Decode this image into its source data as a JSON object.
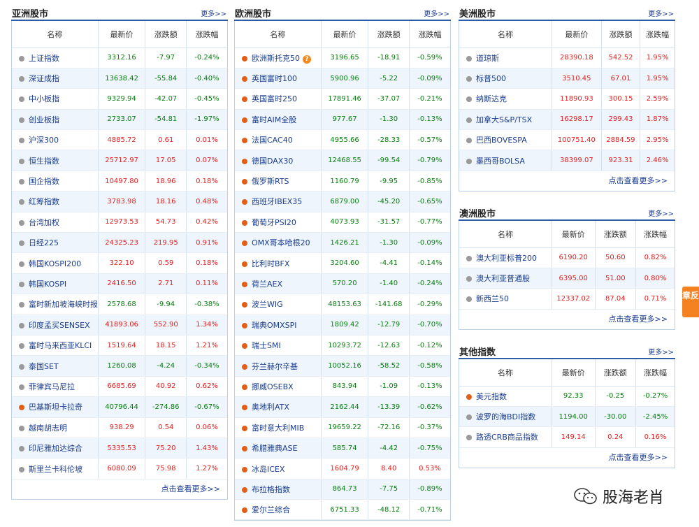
{
  "asia": {
    "title": "亚洲股市",
    "more": "更多>>",
    "footer": "点击查看更多>>",
    "headers": [
      "名称",
      "最新价",
      "涨跌额",
      "涨跌幅"
    ],
    "rows": [
      {
        "name": "上证指数",
        "price": "3312.16",
        "change": "-7.97",
        "pct": "-0.24%",
        "dot": "gray",
        "dir": "down"
      },
      {
        "name": "深证成指",
        "price": "13638.42",
        "change": "-55.84",
        "pct": "-0.40%",
        "dot": "gray",
        "dir": "down"
      },
      {
        "name": "中小板指",
        "price": "9329.94",
        "change": "-42.07",
        "pct": "-0.45%",
        "dot": "gray",
        "dir": "down"
      },
      {
        "name": "创业板指",
        "price": "2733.07",
        "change": "-54.81",
        "pct": "-1.97%",
        "dot": "gray",
        "dir": "down"
      },
      {
        "name": "沪深300",
        "price": "4885.72",
        "change": "0.61",
        "pct": "0.01%",
        "dot": "gray",
        "dir": "up"
      },
      {
        "name": "恒生指数",
        "price": "25712.97",
        "change": "17.05",
        "pct": "0.07%",
        "dot": "gray",
        "dir": "up"
      },
      {
        "name": "国企指数",
        "price": "10497.80",
        "change": "18.96",
        "pct": "0.18%",
        "dot": "gray",
        "dir": "up"
      },
      {
        "name": "红筹指数",
        "price": "3783.98",
        "change": "18.16",
        "pct": "0.48%",
        "dot": "gray",
        "dir": "up"
      },
      {
        "name": "台湾加权",
        "price": "12973.53",
        "change": "54.73",
        "pct": "0.42%",
        "dot": "gray",
        "dir": "up"
      },
      {
        "name": "日经225",
        "price": "24325.23",
        "change": "219.95",
        "pct": "0.91%",
        "dot": "gray",
        "dir": "up"
      },
      {
        "name": "韩国KOSPI200",
        "price": "322.10",
        "change": "0.59",
        "pct": "0.18%",
        "dot": "gray",
        "dir": "up"
      },
      {
        "name": "韩国KOSPI",
        "price": "2416.50",
        "change": "2.71",
        "pct": "0.11%",
        "dot": "gray",
        "dir": "up"
      },
      {
        "name": "富时新加坡海峡时报",
        "price": "2578.68",
        "change": "-9.94",
        "pct": "-0.38%",
        "dot": "gray",
        "dir": "down"
      },
      {
        "name": "印度孟买SENSEX",
        "price": "41893.06",
        "change": "552.90",
        "pct": "1.34%",
        "dot": "gray",
        "dir": "up"
      },
      {
        "name": "富时马来西亚KLCI",
        "price": "1519.64",
        "change": "18.15",
        "pct": "1.21%",
        "dot": "gray",
        "dir": "up"
      },
      {
        "name": "泰国SET",
        "price": "1260.08",
        "change": "-4.24",
        "pct": "-0.34%",
        "dot": "gray",
        "dir": "down"
      },
      {
        "name": "菲律宾马尼拉",
        "price": "6685.69",
        "change": "40.92",
        "pct": "0.62%",
        "dot": "gray",
        "dir": "up"
      },
      {
        "name": "巴基斯坦卡拉奇",
        "price": "40796.44",
        "change": "-274.86",
        "pct": "-0.67%",
        "dot": "orange",
        "dir": "down"
      },
      {
        "name": "越南胡志明",
        "price": "938.29",
        "change": "0.54",
        "pct": "0.06%",
        "dot": "gray",
        "dir": "up"
      },
      {
        "name": "印尼雅加达综合",
        "price": "5335.53",
        "change": "75.20",
        "pct": "1.43%",
        "dot": "gray",
        "dir": "up"
      },
      {
        "name": "斯里兰卡科伦坡",
        "price": "6080.09",
        "change": "75.98",
        "pct": "1.27%",
        "dot": "gray",
        "dir": "up"
      }
    ]
  },
  "europe": {
    "title": "欧洲股市",
    "more": "更多>>",
    "headers": [
      "名称",
      "最新价",
      "涨跌额",
      "涨跌幅"
    ],
    "rows": [
      {
        "name": "欧洲斯托克50",
        "price": "3196.65",
        "change": "-18.91",
        "pct": "-0.59%",
        "dot": "orange",
        "dir": "down",
        "help": "?"
      },
      {
        "name": "英国富时100",
        "price": "5900.96",
        "change": "-5.22",
        "pct": "-0.09%",
        "dot": "orange",
        "dir": "down"
      },
      {
        "name": "英国富时250",
        "price": "17891.46",
        "change": "-37.07",
        "pct": "-0.21%",
        "dot": "orange",
        "dir": "down"
      },
      {
        "name": "富时AIM全股",
        "price": "977.67",
        "change": "-1.30",
        "pct": "-0.13%",
        "dot": "orange",
        "dir": "down"
      },
      {
        "name": "法国CAC40",
        "price": "4955.66",
        "change": "-28.33",
        "pct": "-0.57%",
        "dot": "orange",
        "dir": "down"
      },
      {
        "name": "德国DAX30",
        "price": "12468.55",
        "change": "-99.54",
        "pct": "-0.79%",
        "dot": "orange",
        "dir": "down"
      },
      {
        "name": "俄罗斯RTS",
        "price": "1160.79",
        "change": "-9.95",
        "pct": "-0.85%",
        "dot": "orange",
        "dir": "down"
      },
      {
        "name": "西班牙IBEX35",
        "price": "6879.00",
        "change": "-45.20",
        "pct": "-0.65%",
        "dot": "orange",
        "dir": "down"
      },
      {
        "name": "葡萄牙PSI20",
        "price": "4073.93",
        "change": "-31.57",
        "pct": "-0.77%",
        "dot": "orange",
        "dir": "down"
      },
      {
        "name": "OMX哥本哈根20",
        "price": "1426.21",
        "change": "-1.30",
        "pct": "-0.09%",
        "dot": "orange",
        "dir": "down"
      },
      {
        "name": "比利时BFX",
        "price": "3204.60",
        "change": "-4.41",
        "pct": "-0.14%",
        "dot": "orange",
        "dir": "down"
      },
      {
        "name": "荷兰AEX",
        "price": "570.20",
        "change": "-1.40",
        "pct": "-0.24%",
        "dot": "orange",
        "dir": "down"
      },
      {
        "name": "波兰WIG",
        "price": "48153.63",
        "change": "-141.68",
        "pct": "-0.29%",
        "dot": "orange",
        "dir": "down"
      },
      {
        "name": "瑞典OMXSPI",
        "price": "1809.42",
        "change": "-12.79",
        "pct": "-0.70%",
        "dot": "orange",
        "dir": "down"
      },
      {
        "name": "瑞士SMI",
        "price": "10293.72",
        "change": "-12.63",
        "pct": "-0.12%",
        "dot": "orange",
        "dir": "down"
      },
      {
        "name": "芬兰赫尔辛基",
        "price": "10052.16",
        "change": "-58.52",
        "pct": "-0.58%",
        "dot": "orange",
        "dir": "down"
      },
      {
        "name": "挪威OSEBX",
        "price": "843.94",
        "change": "-1.09",
        "pct": "-0.13%",
        "dot": "orange",
        "dir": "down"
      },
      {
        "name": "奥地利ATX",
        "price": "2162.44",
        "change": "-13.39",
        "pct": "-0.62%",
        "dot": "orange",
        "dir": "down"
      },
      {
        "name": "富时意大利MIB",
        "price": "19659.22",
        "change": "-72.16",
        "pct": "-0.37%",
        "dot": "orange",
        "dir": "down"
      },
      {
        "name": "希腊雅典ASE",
        "price": "585.74",
        "change": "-4.42",
        "pct": "-0.75%",
        "dot": "orange",
        "dir": "down"
      },
      {
        "name": "冰岛ICEX",
        "price": "1604.79",
        "change": "8.40",
        "pct": "0.53%",
        "dot": "orange",
        "dir": "up"
      },
      {
        "name": "布拉格指数",
        "price": "864.73",
        "change": "-7.75",
        "pct": "-0.89%",
        "dot": "orange",
        "dir": "down"
      },
      {
        "name": "爱尔兰综合",
        "price": "6751.33",
        "change": "-48.12",
        "pct": "-0.71%",
        "dot": "orange",
        "dir": "down"
      }
    ]
  },
  "america": {
    "title": "美洲股市",
    "more": "更多>>",
    "footer": "点击查看更多>>",
    "headers": [
      "名称",
      "最新价",
      "涨跌额",
      "涨跌幅"
    ],
    "rows": [
      {
        "name": "道琼斯",
        "price": "28390.18",
        "change": "542.52",
        "pct": "1.95%",
        "dot": "gray",
        "dir": "up"
      },
      {
        "name": "标普500",
        "price": "3510.45",
        "change": "67.01",
        "pct": "1.95%",
        "dot": "gray",
        "dir": "up"
      },
      {
        "name": "纳斯达克",
        "price": "11890.93",
        "change": "300.15",
        "pct": "2.59%",
        "dot": "gray",
        "dir": "up"
      },
      {
        "name": "加拿大S&P/TSX",
        "price": "16298.17",
        "change": "299.43",
        "pct": "1.87%",
        "dot": "gray",
        "dir": "up"
      },
      {
        "name": "巴西BOVESPA",
        "price": "100751.40",
        "change": "2884.59",
        "pct": "2.95%",
        "dot": "gray",
        "dir": "up"
      },
      {
        "name": "墨西哥BOLSA",
        "price": "38399.07",
        "change": "923.31",
        "pct": "2.46%",
        "dot": "gray",
        "dir": "up"
      }
    ]
  },
  "oceania": {
    "title": "澳洲股市",
    "more": "更多>>",
    "footer": "点击查看更多>>",
    "headers": [
      "名称",
      "最新价",
      "涨跌额",
      "涨跌幅"
    ],
    "rows": [
      {
        "name": "澳大利亚标普200",
        "price": "6190.20",
        "change": "50.60",
        "pct": "0.82%",
        "dot": "gray",
        "dir": "up"
      },
      {
        "name": "澳大利亚普通股",
        "price": "6395.00",
        "change": "51.00",
        "pct": "0.80%",
        "dot": "gray",
        "dir": "up"
      },
      {
        "name": "新西兰50",
        "price": "12337.02",
        "change": "87.04",
        "pct": "0.71%",
        "dot": "gray",
        "dir": "up"
      }
    ]
  },
  "other": {
    "title": "其他指数",
    "more": "更多>>",
    "footer": "点击查看更多>>",
    "headers": [
      "名称",
      "最新价",
      "涨跌额",
      "涨跌幅"
    ],
    "rows": [
      {
        "name": "美元指数",
        "price": "92.33",
        "change": "-0.25",
        "pct": "-0.27%",
        "dot": "orange",
        "dir": "down"
      },
      {
        "name": "波罗的海BDI指数",
        "price": "1194.00",
        "change": "-30.00",
        "pct": "-2.45%",
        "dot": "gray",
        "dir": "down"
      },
      {
        "name": "路透CRB商品指数",
        "price": "149.14",
        "change": "0.24",
        "pct": "0.16%",
        "dot": "gray",
        "dir": "up"
      }
    ]
  },
  "side_tab": "章反",
  "watermark": "股海老肖",
  "colors": {
    "up": "#e02020",
    "down": "#077d0e",
    "accent": "#2a5ca8",
    "dot_orange": "#e0601a",
    "dot_gray": "#9a9a9a"
  }
}
